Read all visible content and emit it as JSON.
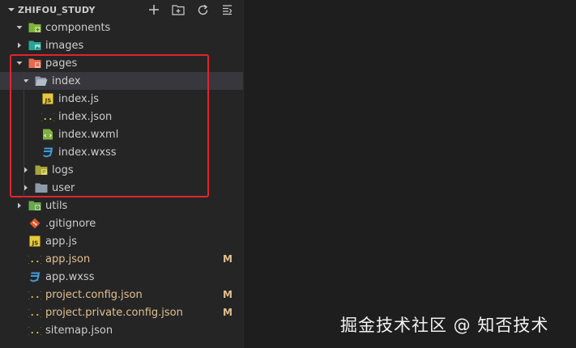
{
  "explorer": {
    "title": "ZHIFOU_STUDY",
    "actions": [
      {
        "name": "new-file",
        "icon": "plus-icon"
      },
      {
        "name": "new-folder",
        "icon": "folder-plus-icon"
      },
      {
        "name": "refresh",
        "icon": "refresh-icon"
      },
      {
        "name": "collapse-all",
        "icon": "collapse-icon"
      }
    ]
  },
  "tree": [
    {
      "label": "components",
      "depth": 0,
      "kind": "folder",
      "expanded": true,
      "icon": "folder-components-icon"
    },
    {
      "label": "images",
      "depth": 0,
      "kind": "folder",
      "expanded": false,
      "icon": "folder-images-icon"
    },
    {
      "label": "pages",
      "depth": 0,
      "kind": "folder",
      "expanded": true,
      "icon": "folder-pages-icon"
    },
    {
      "label": "index",
      "depth": 1,
      "kind": "folder",
      "expanded": true,
      "icon": "folder-open-icon",
      "selected": true
    },
    {
      "label": "index.js",
      "depth": 2,
      "kind": "file",
      "icon": "js-file-icon"
    },
    {
      "label": "index.json",
      "depth": 2,
      "kind": "file",
      "icon": "json-file-icon"
    },
    {
      "label": "index.wxml",
      "depth": 2,
      "kind": "file",
      "icon": "wxml-file-icon"
    },
    {
      "label": "index.wxss",
      "depth": 2,
      "kind": "file",
      "icon": "wxss-file-icon"
    },
    {
      "label": "logs",
      "depth": 1,
      "kind": "folder",
      "expanded": false,
      "icon": "folder-logs-icon"
    },
    {
      "label": "user",
      "depth": 1,
      "kind": "folder",
      "expanded": false,
      "icon": "folder-icon"
    },
    {
      "label": "utils",
      "depth": 0,
      "kind": "folder",
      "expanded": false,
      "icon": "folder-utils-icon"
    },
    {
      "label": ".gitignore",
      "depth": 0,
      "kind": "file",
      "icon": "git-icon"
    },
    {
      "label": "app.js",
      "depth": 0,
      "kind": "file",
      "icon": "js-file-icon"
    },
    {
      "label": "app.json",
      "depth": 0,
      "kind": "file",
      "icon": "json-file-icon",
      "modified": true,
      "badge": "M"
    },
    {
      "label": "app.wxss",
      "depth": 0,
      "kind": "file",
      "icon": "wxss-file-icon"
    },
    {
      "label": "project.config.json",
      "depth": 0,
      "kind": "file",
      "icon": "json-file-icon",
      "modified": true,
      "badge": "M"
    },
    {
      "label": "project.private.config.json",
      "depth": 0,
      "kind": "file",
      "icon": "json-file-icon",
      "modified": true,
      "badge": "M"
    },
    {
      "label": "sitemap.json",
      "depth": 0,
      "kind": "file",
      "icon": "json-file-icon"
    }
  ],
  "watermark": "掘金技术社区 @ 知否技术",
  "colors": {
    "modified": "#e2c08d",
    "highlight": "#e3242b",
    "selected_row": "#37373d"
  }
}
